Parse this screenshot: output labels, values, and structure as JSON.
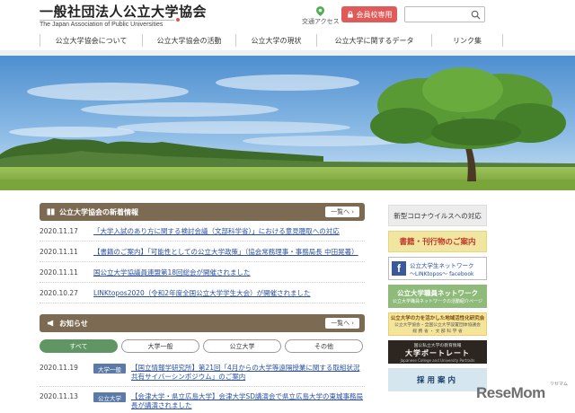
{
  "header": {
    "logo_title": "一般社団法人公立大学協会",
    "logo_subtitle": "The Japan Association of Public Universities",
    "access_label": "交通アクセス",
    "member_button": "会員校専用",
    "search_placeholder": ""
  },
  "nav": {
    "items": [
      {
        "label": "公立大学協会について"
      },
      {
        "label": "公立大学協会の活動"
      },
      {
        "label": "公立大学の現状"
      },
      {
        "label": "公立大学に関するデータ"
      },
      {
        "label": "リンク集"
      }
    ]
  },
  "news": {
    "title": "公立大学協会の新着情報",
    "list_button": "一覧へ",
    "items": [
      {
        "date": "2020.11.17",
        "text": "「大学入試のあり方に関する検討会議（文部科学省）」における意見聴取への対応"
      },
      {
        "date": "2020.11.11",
        "text": "【書籍のご案内】「可能性としての公立大学政策」（協会常務理事・事務局長 中田晃著）"
      },
      {
        "date": "2020.11.11",
        "text": "国公立大学協議員連盟第18回総会が開催されました"
      },
      {
        "date": "2020.10.27",
        "text": "LINKtopos2020（令和2年度全国公立大学学生大会）が開催されました"
      }
    ]
  },
  "notices": {
    "title": "お知らせ",
    "list_button": "一覧へ",
    "tabs": [
      {
        "label": "すべて"
      },
      {
        "label": "大学一般"
      },
      {
        "label": "公立大学"
      },
      {
        "label": "その他"
      }
    ],
    "items": [
      {
        "date": "2020.11.19",
        "badge": "大学一般",
        "line1": "【国立情報学研究所】第21回「4月からの大学等遠隔授業に関する取組状況",
        "line2": "共有サイバーシンポジウム」のご案内"
      },
      {
        "date": "2020.11.13",
        "badge": "公立大学",
        "line1": "【会津大学・県立広島大学】会津大学SD講演会で県立広島大学の東城事務局",
        "line2": "長が講演されました"
      }
    ]
  },
  "sidebar": {
    "corona": "新型コロナウイルスへの対応",
    "books": "書籍・刊行物のご案内",
    "fb_title": "公立大学生ネットワーク",
    "fb_sub": "～LINKtopos～ facebook",
    "staff_title": "公立大学職員ネットワーク",
    "staff_sub": "公立大学職員ネットワークの活動紹介ページ",
    "regional_title": "公立大学の力を活かした地域活性化研究会",
    "regional_sub": "公立大学協会・全国公立大学設置団体協議会",
    "regional_sub2": "総 務 省 ・ 文 部 科 学 省",
    "portrait_top": "国公私立大学の教育情報",
    "portrait_title": "大学ポートレート",
    "portrait_sub": "Japanese College and University Portraits",
    "recruit": "採用案内"
  },
  "watermark": {
    "text": "ReseMom",
    "sub": "リセマム"
  },
  "colors": {
    "brown_header": "#7d6a52",
    "member_red": "#e05a5a",
    "tab_green": "#5f9664",
    "link_blue": "#2a4fa0"
  }
}
